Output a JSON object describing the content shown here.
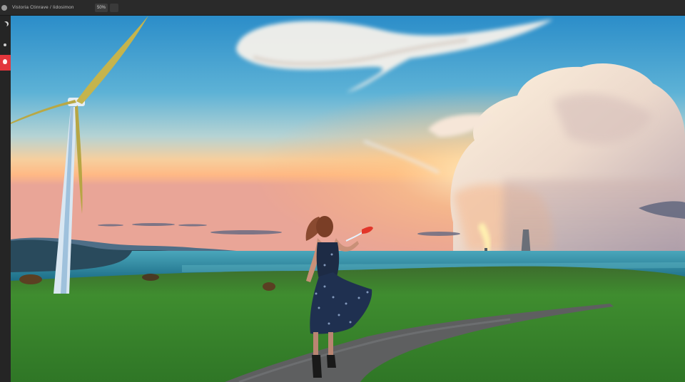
{
  "topbar": {
    "title": "Vistoria Ctinrave / Iidosimon",
    "zoom": "50%"
  },
  "tools": [
    {
      "icon": "moon-icon"
    },
    {
      "icon": "dot-icon"
    },
    {
      "icon": "flame-icon",
      "active": true
    }
  ],
  "colors": {
    "chrome_bg": "#1e1e1e",
    "topbar_bg": "#2a2a2a",
    "active_tool": "#e2363c",
    "sky_top": "#2d8fca",
    "sunset": "#ffc182",
    "sea": "#2a8fa3",
    "grass": "#3c8a2f"
  }
}
